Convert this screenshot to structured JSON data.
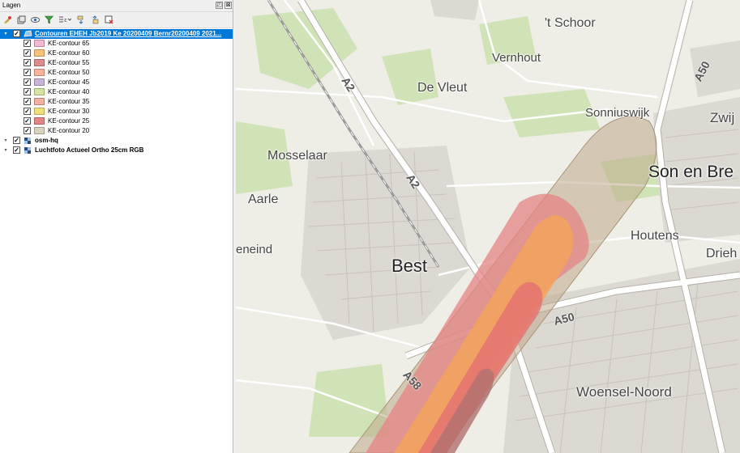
{
  "panel": {
    "title": "Lagen",
    "float_btn": "◰",
    "close_btn": "⊠",
    "toolbar_icons": [
      "style-icon",
      "add-group-icon",
      "visibility-icon",
      "filter-icon",
      "filter-legend-icon",
      "expand-all-icon",
      "collapse-all-icon",
      "remove-layer-icon"
    ]
  },
  "layers": {
    "group": {
      "label": "Contouren EHEH Jb2019 Ke 20200409 Bernr20200409 2021...",
      "checked": true
    },
    "contours": [
      {
        "label": "KE-contour 65",
        "color": "#f4b8d6"
      },
      {
        "label": "KE-contour 60",
        "color": "#f8c27a"
      },
      {
        "label": "KE-contour 55",
        "color": "#dd8c8c"
      },
      {
        "label": "KE-contour 50",
        "color": "#f6b49a"
      },
      {
        "label": "KE-contour 45",
        "color": "#c9b4d8"
      },
      {
        "label": "KE-contour 40",
        "color": "#d6e4a0"
      },
      {
        "label": "KE-contour 35",
        "color": "#f2b0a0"
      },
      {
        "label": "KE-contour 30",
        "color": "#f2e07c"
      },
      {
        "label": "KE-contour 25",
        "color": "#e48484"
      },
      {
        "label": "KE-contour 20",
        "color": "#d9d2bc"
      }
    ],
    "others": [
      {
        "label": "osm-hq",
        "checked": true
      },
      {
        "label": "Luchtfoto Actueel Ortho 25cm RGB",
        "checked": true
      }
    ],
    "check_mark": "✓",
    "expander": "▾"
  },
  "map": {
    "places": {
      "schoor": "'t Schoor",
      "vernhout": "Vernhout",
      "vleut": "De Vleut",
      "sonniuswijk": "Sonniuswijk",
      "zwijk": "Zwij",
      "mosselaar": "Mosselaar",
      "son": "Son en Bre",
      "aarle": "Aarle",
      "houtens": "Houtens",
      "eneind": "eneind",
      "best": "Best",
      "driehoek": "Drieh",
      "woensel": "Woensel-Noord"
    },
    "roads": {
      "a2_north": "A2",
      "a2_mid": "A2",
      "a50_ne": "A50",
      "a50_east": "A50",
      "a58": "A58"
    }
  }
}
